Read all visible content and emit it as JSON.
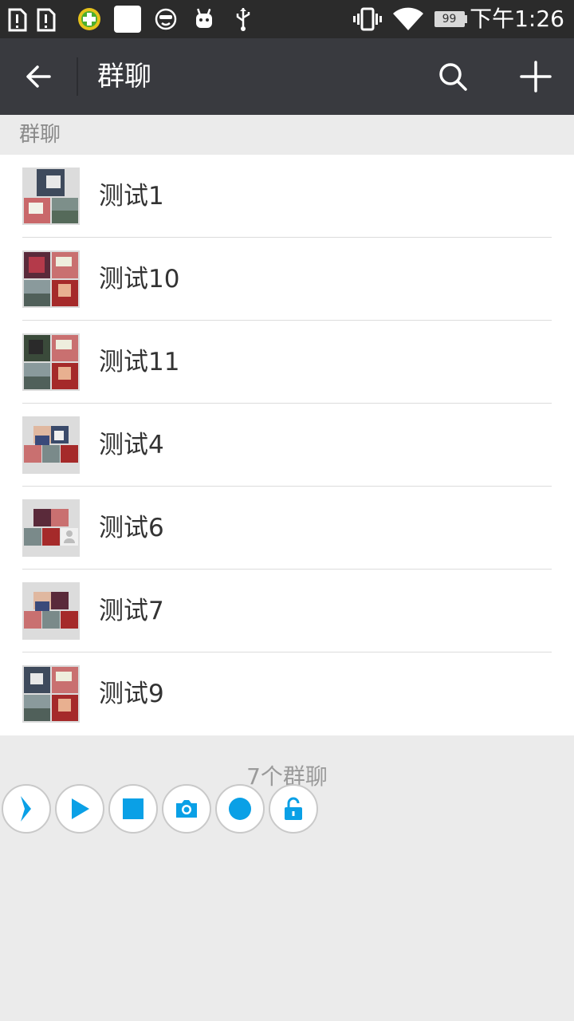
{
  "status_bar": {
    "time": "下午1:26",
    "battery": "99",
    "icons": [
      "sim-alert-icon",
      "sim-alert-icon",
      "360-security-icon",
      "blank-notification-icon",
      "face-icon",
      "android-icon",
      "usb-icon",
      "vibrate-icon",
      "wifi-icon",
      "battery-icon"
    ]
  },
  "app_bar": {
    "title": "群聊",
    "back_icon": "arrow-left-icon",
    "search_icon": "search-icon",
    "add_icon": "plus-icon"
  },
  "section": {
    "label": "群聊"
  },
  "groups": [
    {
      "name": "测试1"
    },
    {
      "name": "测试10"
    },
    {
      "name": "测试11"
    },
    {
      "name": "测试4"
    },
    {
      "name": "测试6"
    },
    {
      "name": "测试7"
    },
    {
      "name": "测试9"
    }
  ],
  "footer": {
    "count_text": "7个群聊"
  },
  "floating_toolbar": {
    "buttons": [
      "chevron-right-icon",
      "play-icon",
      "stop-icon",
      "camera-icon",
      "record-icon",
      "unlock-icon"
    ],
    "accent": "#0aa0e6"
  },
  "colors": {
    "app_bar_bg": "#393a3f",
    "status_bar_bg": "#2b2b2b",
    "page_bg": "#ebebeb"
  }
}
